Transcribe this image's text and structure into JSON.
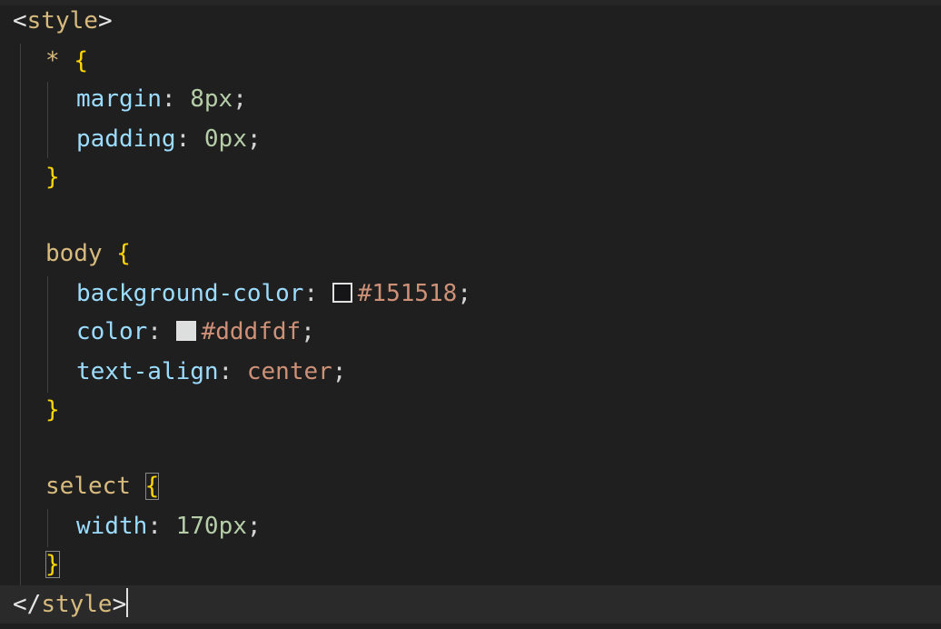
{
  "code": {
    "open_tag": "style",
    "close_tag": "style",
    "rules": [
      {
        "selector": "*",
        "declarations": [
          {
            "property": "margin",
            "number": "8",
            "unit": "px"
          },
          {
            "property": "padding",
            "number": "0",
            "unit": "px"
          }
        ]
      },
      {
        "selector": "body",
        "declarations": [
          {
            "property": "background-color",
            "value": "#151518",
            "swatch_color": "#151518"
          },
          {
            "property": "color",
            "value": "#dddfdf",
            "swatch_color": "#dddfdf"
          },
          {
            "property": "text-align",
            "value": "center"
          }
        ]
      },
      {
        "selector": "select",
        "declarations": [
          {
            "property": "width",
            "number": "170",
            "unit": "px"
          }
        ]
      }
    ],
    "open_brace": "{",
    "close_brace": "}",
    "colon": ":",
    "semicolon": ";"
  }
}
